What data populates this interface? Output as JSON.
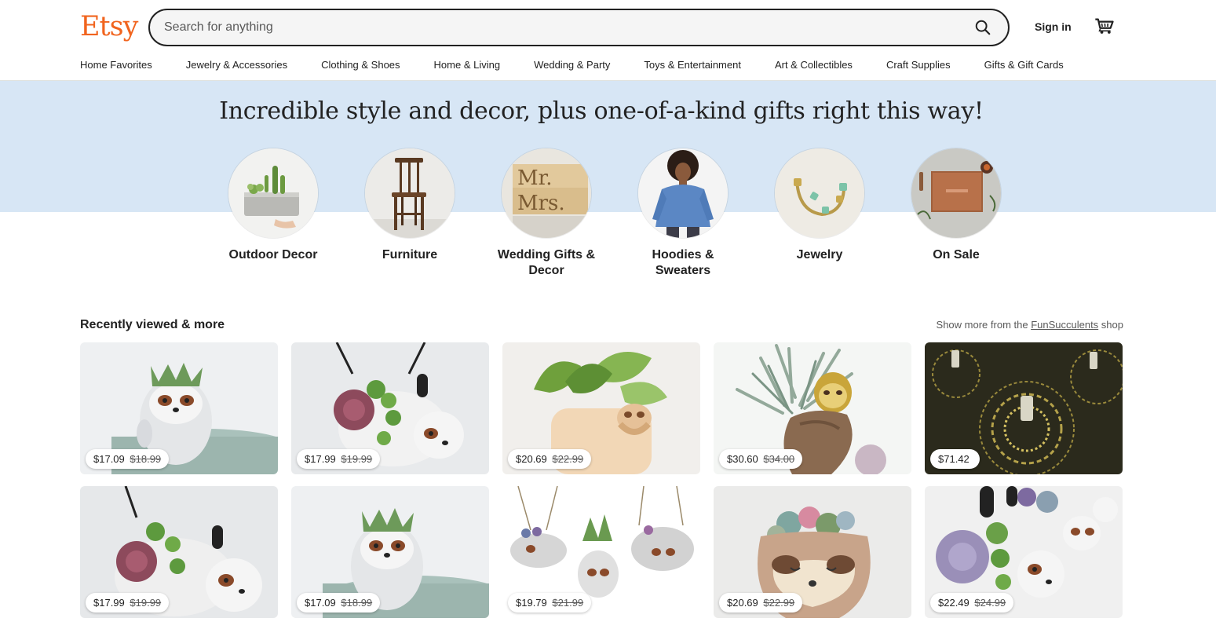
{
  "header": {
    "logo": "Etsy",
    "search_placeholder": "Search for anything",
    "signin_label": "Sign in",
    "search_icon": "search-icon",
    "cart_icon": "cart-icon",
    "accent_color": "#F1641E"
  },
  "nav": [
    "Home Favorites",
    "Jewelry & Accessories",
    "Clothing & Shoes",
    "Home & Living",
    "Wedding & Party",
    "Toys & Entertainment",
    "Art & Collectibles",
    "Craft Supplies",
    "Gifts & Gift Cards"
  ],
  "hero": {
    "title": "Incredible style and decor, plus one-of-a-kind gifts right this way!",
    "band_color": "#d7e6f5",
    "categories": [
      {
        "label": "Outdoor Decor"
      },
      {
        "label": "Furniture"
      },
      {
        "label": "Wedding Gifts & Decor"
      },
      {
        "label": "Hoodies & Sweaters"
      },
      {
        "label": "Jewelry"
      },
      {
        "label": "On Sale"
      }
    ]
  },
  "recently_viewed": {
    "title": "Recently viewed & more",
    "more_prefix": "Show more from the ",
    "shop_link": "FunSucculents",
    "more_suffix": " shop",
    "items": [
      {
        "price": "$17.09",
        "original": "$18.99"
      },
      {
        "price": "$17.99",
        "original": "$19.99"
      },
      {
        "price": "$20.69",
        "original": "$22.99"
      },
      {
        "price": "$30.60",
        "original": "$34.00"
      },
      {
        "price": "$71.42",
        "original": ""
      },
      {
        "price": "$17.99",
        "original": "$19.99"
      },
      {
        "price": "$17.09",
        "original": "$18.99"
      },
      {
        "price": "$19.79",
        "original": "$21.99"
      },
      {
        "price": "$20.69",
        "original": "$22.99"
      },
      {
        "price": "$22.49",
        "original": "$24.99"
      }
    ]
  }
}
